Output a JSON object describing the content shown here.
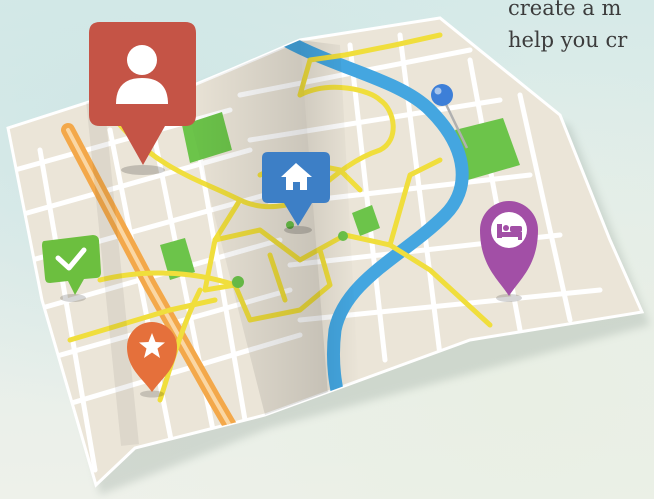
{
  "caption": {
    "line1": "create a m",
    "line2": "help you cr"
  },
  "colors": {
    "land": "#ebe5d8",
    "road": "#ffffff",
    "major_road": "#f0de3c",
    "highway": "#f3a84a",
    "river": "#44a6e0",
    "park": "#6cc44a",
    "user_pin": "#c55446",
    "home_pin": "#3d7fc6",
    "check_pin": "#6cbf3f",
    "star_pin": "#e5703b",
    "hotel_pin": "#a24fa6",
    "location_pin": "#3d7fd8"
  },
  "markers": [
    {
      "name": "user-marker-icon",
      "icon": "person-icon"
    },
    {
      "name": "home-marker-icon",
      "icon": "home-icon"
    },
    {
      "name": "check-marker-icon",
      "icon": "checkmark-icon"
    },
    {
      "name": "star-marker-icon",
      "icon": "star-icon"
    },
    {
      "name": "hotel-marker-icon",
      "icon": "bed-icon"
    },
    {
      "name": "location-pin-icon",
      "icon": "map-pin-icon"
    }
  ]
}
